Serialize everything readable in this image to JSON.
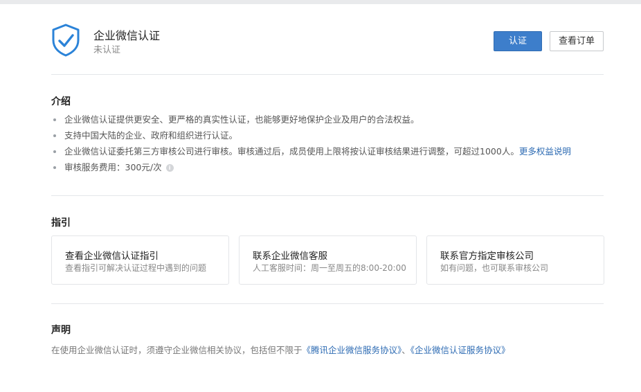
{
  "header": {
    "title": "企业微信认证",
    "status": "未认证",
    "verify_button": "认证",
    "orders_button": "查看订单",
    "shield_color": "#2b83d8"
  },
  "intro": {
    "heading": "介绍",
    "items": [
      "企业微信认证提供更安全、更严格的真实性认证，也能够更好地保护企业及用户的合法权益。",
      "支持中国大陆的企业、政府和组织进行认证。",
      "企业微信认证委托第三方审核公司进行审核。审核通过后，成员使用上限将按认证审核结果进行调整，可超过1000人。",
      "审核服务费用：300元/次"
    ],
    "more_link": "更多权益说明",
    "info_glyph": "i"
  },
  "guide": {
    "heading": "指引",
    "cards": [
      {
        "title": "查看企业微信认证指引",
        "desc": "查看指引可解决认证过程中遇到的问题"
      },
      {
        "title": "联系企业微信客服",
        "desc": "人工客服时间：周一至周五的8:00-20:00"
      },
      {
        "title": "联系官方指定审核公司",
        "desc": "如有问题，也可联系审核公司"
      }
    ]
  },
  "statement": {
    "heading": "声明",
    "text": "在使用企业微信认证时，须遵守企业微信相关协议，包括但不限于",
    "link1": "《腾讯企业微信服务协议》",
    "separator": "、",
    "link2": "《企业微信认证服务协议》"
  }
}
